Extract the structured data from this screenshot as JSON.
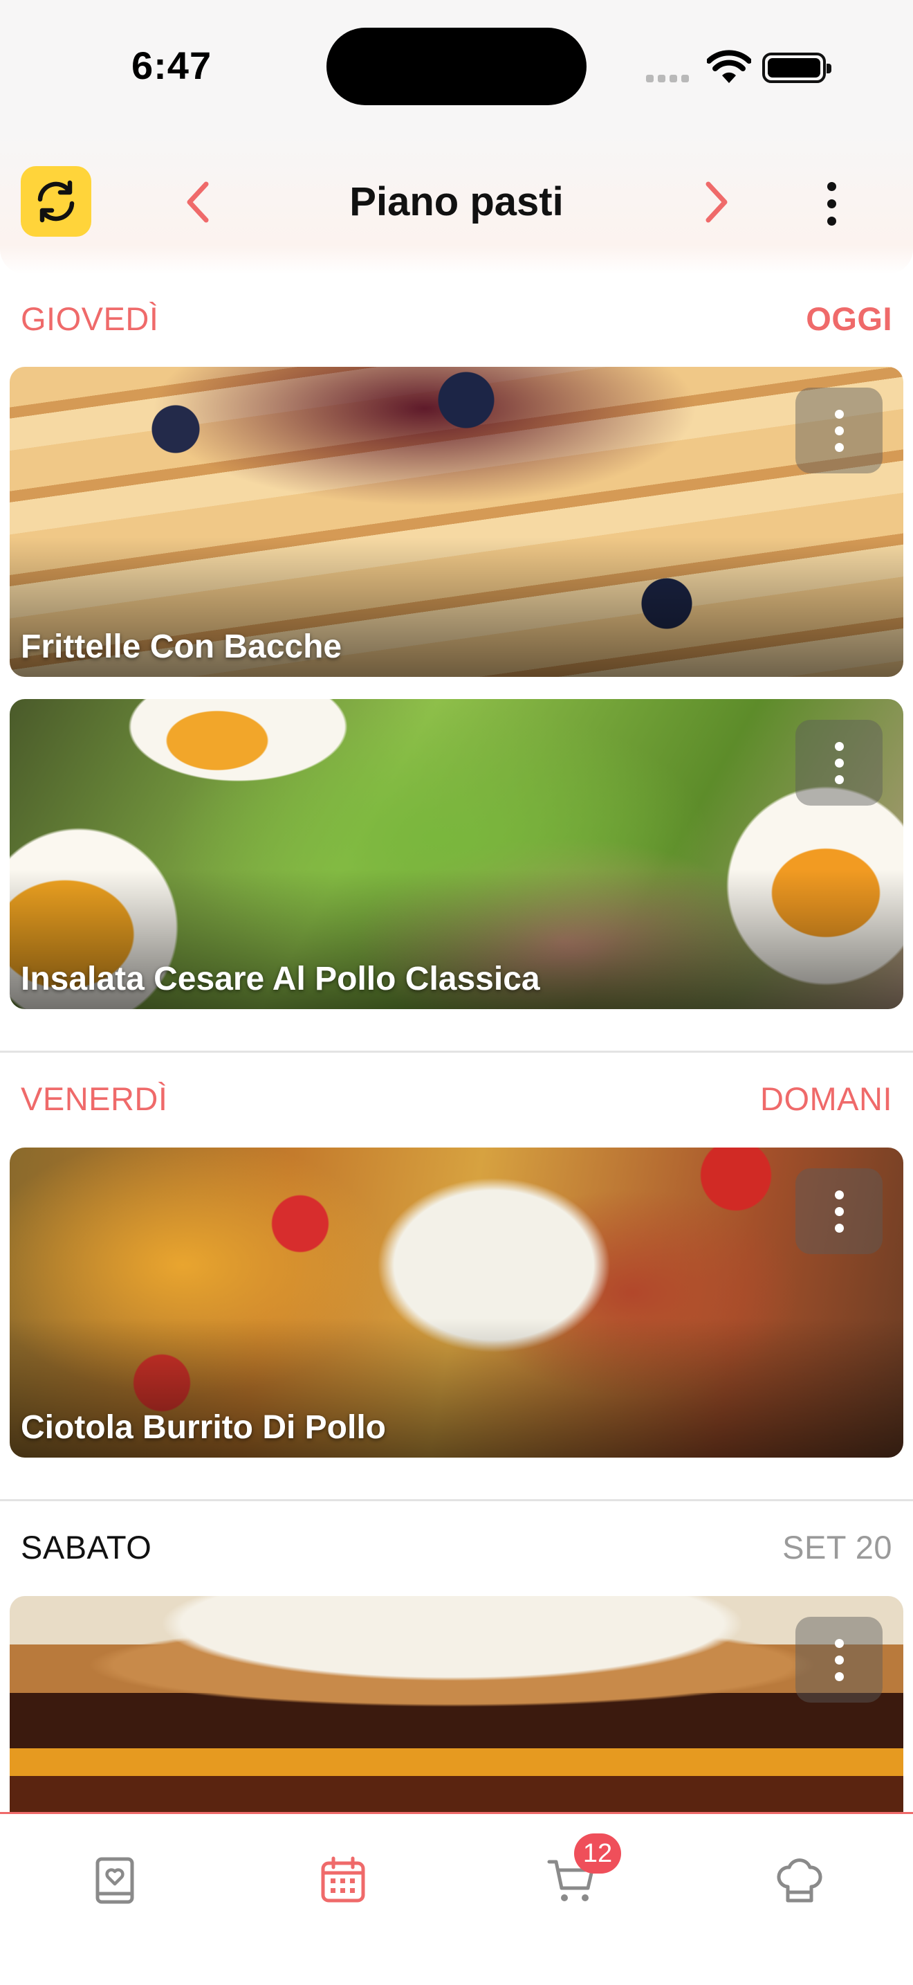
{
  "status_bar": {
    "time": "6:47"
  },
  "header": {
    "title": "Piano pasti"
  },
  "days": [
    {
      "label": "GIOVEDÌ",
      "tag": "OGGI",
      "meals": [
        {
          "title": "Frittelle Con Bacche"
        },
        {
          "title": "Insalata Cesare Al Pollo Classica"
        }
      ]
    },
    {
      "label": "VENERDÌ",
      "tag": "DOMANI",
      "meals": [
        {
          "title": "Ciotola Burrito Di Pollo"
        }
      ]
    },
    {
      "label": "SABATO",
      "tag": "SET 20",
      "meals": [
        {
          "title": ""
        }
      ]
    }
  ],
  "tab_bar": {
    "items": [
      {
        "name": "recipes",
        "icon": "recipe-book-icon",
        "active": false
      },
      {
        "name": "meal-plan",
        "icon": "calendar-icon",
        "active": true
      },
      {
        "name": "shopping-list",
        "icon": "cart-icon",
        "active": false,
        "badge": "12"
      },
      {
        "name": "chef",
        "icon": "chef-hat-icon",
        "active": false
      }
    ]
  },
  "colors": {
    "accent": "#ef6a6a",
    "sync_button": "#ffd43a",
    "badge": "#ef4f5a"
  }
}
